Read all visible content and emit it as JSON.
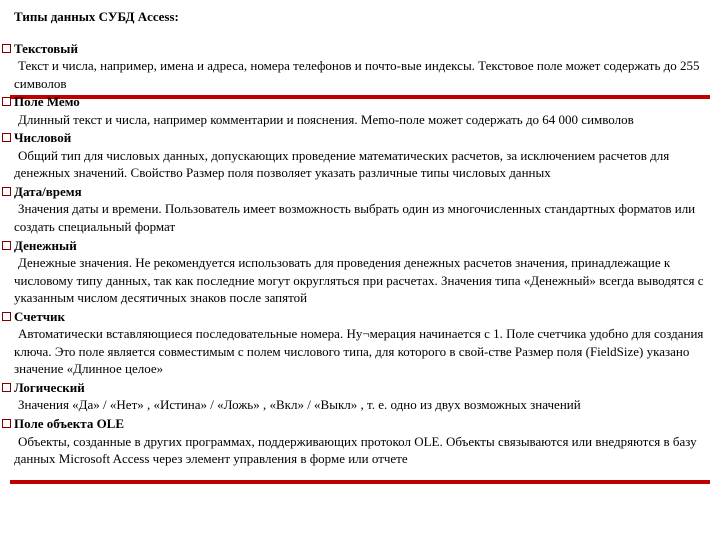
{
  "title": "Типы данных СУБД Access:",
  "entries": [
    {
      "term": "Текстовый",
      "desc": "Текст и числа, например, имена и адреса, номера телефонов и почто-вые индексы. Текстовое поле может содержать до 255 символов"
    },
    {
      "term": "Поле Мемо",
      "desc": "Длинный текст и числа, например комментарии и пояснения. Memo-поле может содержать до 64 000 символов"
    },
    {
      "term": "Числовой",
      "desc": "Общий тип для числовых данных, допускающих проведение математических расчетов, за исключением расчетов для денежных значений. Свойство Размер поля позволяет указать различные типы числовых данных"
    },
    {
      "term": "Дата/время",
      "desc": "Значения даты и времени. Пользователь имеет возможность выбрать один из многочисленных стандартных форматов или создать специальный формат"
    },
    {
      "term": "Денежный",
      "desc": "Денежные значения. Не рекомендуется использовать для проведения денежных расчетов значения, принадлежащие к числовому типу данных, так как последние могут округляться при расчетах. Значения типа «Денежный» всегда выводятся с указанным числом десятичных знаков после запятой"
    },
    {
      "term": "Счетчик",
      "desc": "Автоматически вставляющиеся последовательные номера. Ну¬мерация начинается с 1. Поле счетчика удобно для создания ключа. Это поле является совместимым с полем числового типа, для которого в свой-стве Размер поля (FieldSize) указано значение «Длинное целое»"
    },
    {
      "term": "Логический",
      "desc": "Значения «Да» / «Нет» , «Истина» / «Ложь» , «Вкл» / «Выкл» , т. е. одно из двух возможных значений"
    },
    {
      "term": "Поле объекта OLE",
      "desc": "Объекты, созданные в других программах, поддерживающих протокол OLE. Объекты связываются или внедряются в базу данных Microsoft Access через элемент управления в форме или отчете"
    }
  ]
}
